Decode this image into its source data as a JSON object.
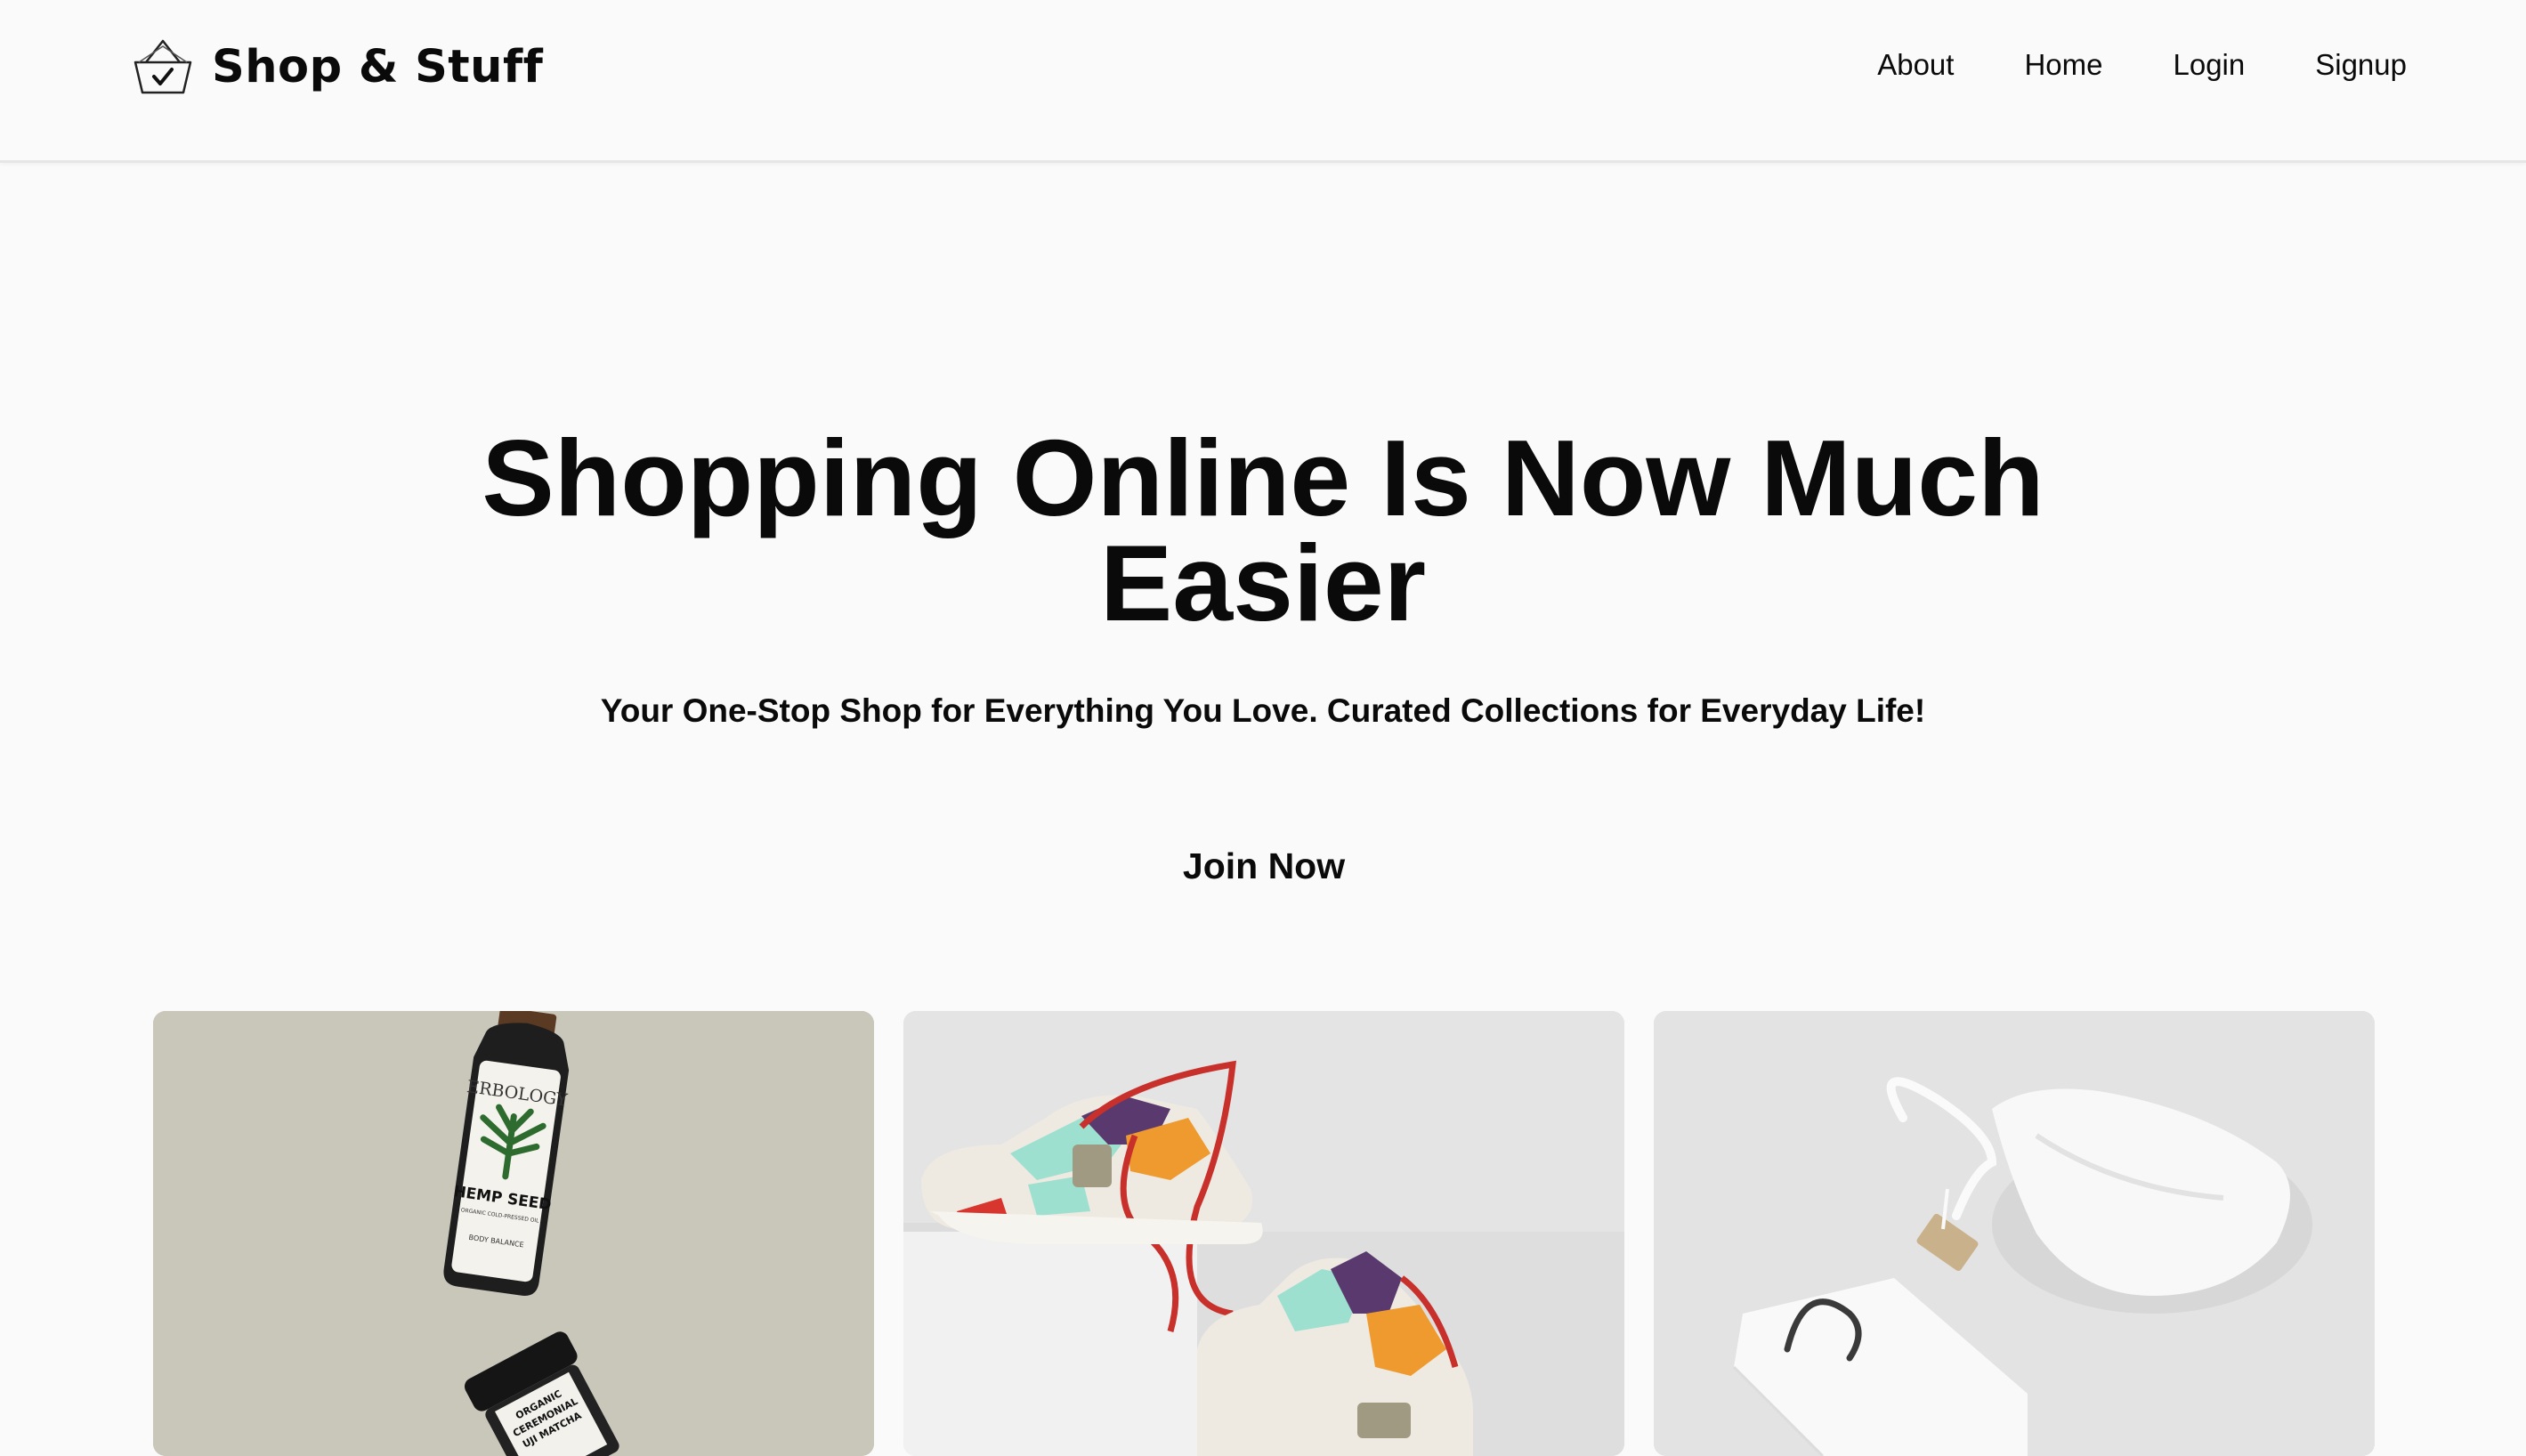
{
  "brand": {
    "name": "Shop & Stuff",
    "icon": "basket-check-icon"
  },
  "nav": {
    "items": [
      {
        "label": "About"
      },
      {
        "label": "Home"
      },
      {
        "label": "Login"
      },
      {
        "label": "Signup"
      }
    ]
  },
  "hero": {
    "title": "Shopping Online Is Now Much Easier",
    "subtitle": "Your One-Stop Shop for Everything You Love. Curated Collections for Everyday Life!",
    "cta_label": "Join Now"
  },
  "products": {
    "bottle_brand": "ERBOLOGY",
    "bottle_label": "HEMP SEED",
    "bottle_sub": "ORGANIC COLD-PRESSED OIL",
    "bottle_note": "BODY BALANCE",
    "jar_label_1": "ORGANIC",
    "jar_label_2": "CEREMONIAL",
    "jar_label_3": "UJI MATCHA"
  },
  "colors": {
    "background": "#fafafa",
    "text": "#0a0a0a",
    "card1_bg": "#c9c6ba",
    "card2_bg": "#e4e4e4",
    "card3_bg": "#e3e3e3"
  }
}
